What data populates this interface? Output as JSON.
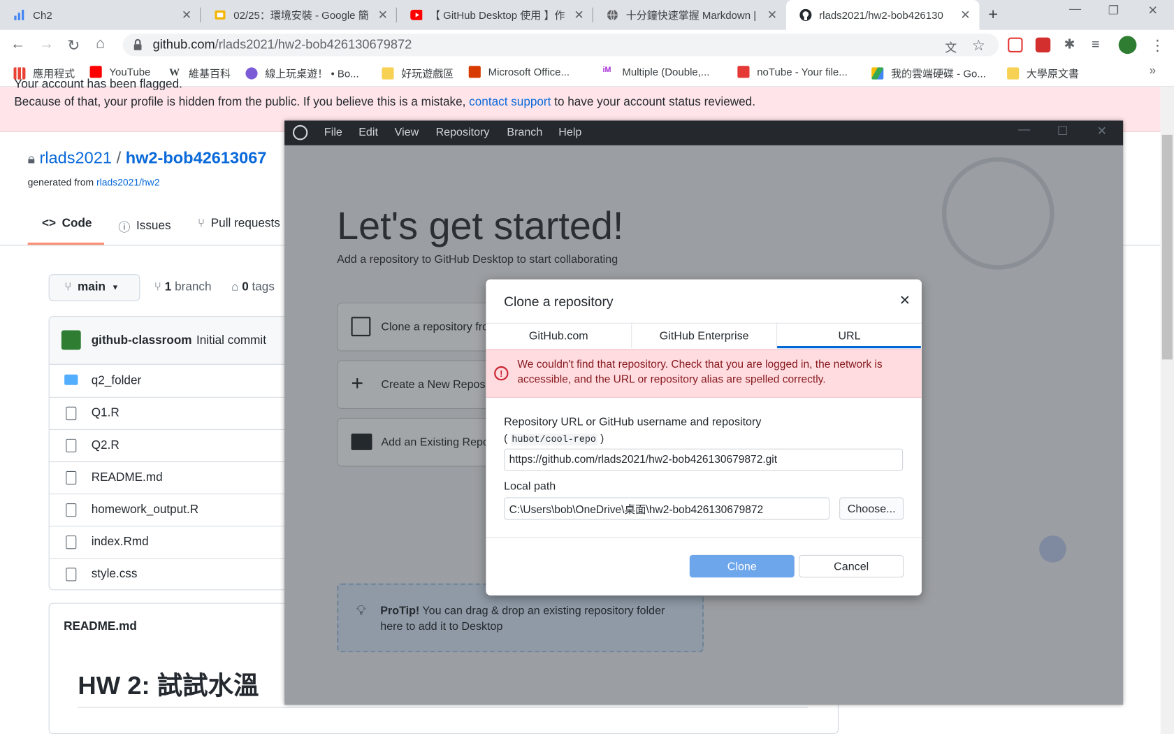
{
  "browser": {
    "tabs": [
      {
        "title": "Ch2",
        "icon": "chart-bars-icon"
      },
      {
        "title": "02/25：環境安裝 - Google 簡",
        "icon": "google-slides-icon"
      },
      {
        "title": "【 GitHub Desktop 使用 】作",
        "icon": "youtube-icon"
      },
      {
        "title": "十分鐘快速掌握 Markdown |",
        "icon": "globe-icon"
      },
      {
        "title": "rlads2021/hw2-bob426130",
        "icon": "github-icon"
      }
    ],
    "url_host": "github.com",
    "url_path": "/rlads2021/hw2-bob426130679872",
    "bookmarks": [
      {
        "label": "應用程式",
        "color": "#ea4335"
      },
      {
        "label": "YouTube",
        "color": "#ff0000"
      },
      {
        "label": "維基百科",
        "color": "#000000"
      },
      {
        "label": "線上玩桌遊！ • Bo...",
        "color": "#7b5cd6"
      },
      {
        "label": "好玩遊戲區",
        "color": "#f7d154"
      },
      {
        "label": "Microsoft Office...",
        "color": "#d83b01"
      },
      {
        "label": "Multiple (Double,...",
        "color": "#a72bd6"
      },
      {
        "label": "noTube - Your file...",
        "color": "#e53935"
      },
      {
        "label": "我的雲端硬碟 - Go...",
        "color": "#34a853"
      },
      {
        "label": "大學原文書",
        "color": "#f7d154"
      }
    ]
  },
  "github": {
    "banner_top": "Your account has been flagged.",
    "banner_text": "Because of that, your profile is hidden from the public. If you believe this is a mistake,",
    "banner_link": "contact support",
    "banner_after": "to have your account status reviewed.",
    "owner": "rlads2021",
    "slash": "/",
    "repo": "hw2-bob42613067",
    "generated_label": "generated from",
    "generated_link": "rlads2021/hw2",
    "tabs": [
      "Code",
      "Issues",
      "Pull requests"
    ],
    "branch": "main",
    "branches_count": "1",
    "branches_label": "branch",
    "tags_count": "0",
    "tags_label": "tags",
    "commit_author": "github-classroom",
    "commit_msg": "Initial commit",
    "files": [
      "q2_folder",
      "Q1.R",
      "Q2.R",
      "README.md",
      "homework_output.R",
      "index.Rmd",
      "style.css"
    ],
    "readme_label": "README.md",
    "readme_heading": "HW 2: 試試水溫"
  },
  "desktop": {
    "menu": [
      "File",
      "Edit",
      "View",
      "Repository",
      "Branch",
      "Help"
    ],
    "heading": "Let's get started!",
    "subheading": "Add a repository to GitHub Desktop to start collaborating",
    "options": [
      "Clone a repository fro",
      "Create a New Reposit",
      "Add an Existing Repo"
    ],
    "protip_label": "ProTip!",
    "protip_text": "You can drag & drop an existing repository folder",
    "protip_text2": "here to add it to Desktop"
  },
  "dialog": {
    "title": "Clone a repository",
    "tabs": [
      "GitHub.com",
      "GitHub Enterprise",
      "URL"
    ],
    "error_line1": "We couldn't find that repository. Check that you are logged in, the network is",
    "error_line2": "accessible, and the URL or repository alias are spelled correctly.",
    "url_label": "Repository URL or GitHub username and repository",
    "hint_open": "(",
    "hint_code": "hubot/cool-repo",
    "hint_close": ")",
    "url_value": "https://github.com/rlads2021/hw2-bob426130679872.git",
    "path_label": "Local path",
    "path_value": "C:\\Users\\bob\\OneDrive\\桌面\\hw2-bob426130679872",
    "choose_label": "Choose...",
    "clone_label": "Clone",
    "cancel_label": "Cancel"
  }
}
